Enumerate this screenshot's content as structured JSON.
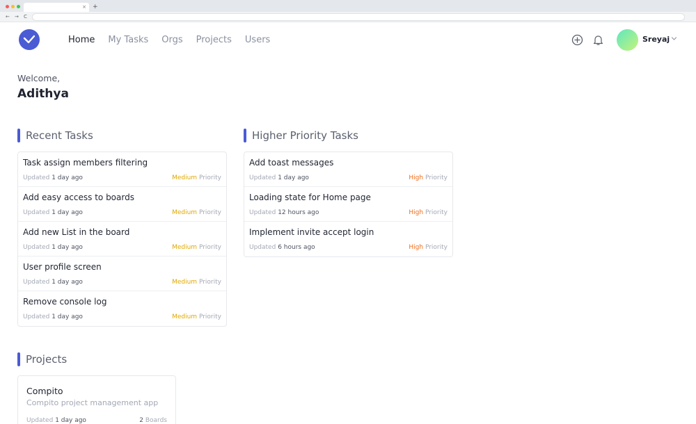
{
  "browser": {
    "tab_close": "×",
    "new_tab": "+",
    "back": "←",
    "forward": "→",
    "reload": "C"
  },
  "nav": {
    "items": [
      {
        "label": "Home",
        "active": true
      },
      {
        "label": "My Tasks",
        "active": false
      },
      {
        "label": "Orgs",
        "active": false
      },
      {
        "label": "Projects",
        "active": false
      },
      {
        "label": "Users",
        "active": false
      }
    ]
  },
  "header": {
    "username": "Sreyaj",
    "add_icon": "plus-circle-icon",
    "bell_icon": "bell-icon"
  },
  "welcome": {
    "greeting": "Welcome,",
    "name": "Adithya"
  },
  "recent_tasks": {
    "title": "Recent Tasks",
    "items": [
      {
        "title": "Task assign members filtering",
        "updated_label": "Updated",
        "updated": "1 day ago",
        "priority": "Medium",
        "priority_suffix": "Priority"
      },
      {
        "title": "Add easy access to boards",
        "updated_label": "Updated",
        "updated": "1 day ago",
        "priority": "Medium",
        "priority_suffix": "Priority"
      },
      {
        "title": "Add new List in the board",
        "updated_label": "Updated",
        "updated": "1 day ago",
        "priority": "Medium",
        "priority_suffix": "Priority"
      },
      {
        "title": "User profile screen",
        "updated_label": "Updated",
        "updated": "1 day ago",
        "priority": "Medium",
        "priority_suffix": "Priority"
      },
      {
        "title": "Remove console log",
        "updated_label": "Updated",
        "updated": "1 day ago",
        "priority": "Medium",
        "priority_suffix": "Priority"
      }
    ]
  },
  "priority_tasks": {
    "title": "Higher Priority Tasks",
    "items": [
      {
        "title": "Add toast messages",
        "updated_label": "Updated",
        "updated": "1 day ago",
        "priority": "High",
        "priority_suffix": "Priority"
      },
      {
        "title": "Loading state for Home page",
        "updated_label": "Updated",
        "updated": "12 hours ago",
        "priority": "High",
        "priority_suffix": "Priority"
      },
      {
        "title": "Implement invite accept login",
        "updated_label": "Updated",
        "updated": "6 hours ago",
        "priority": "High",
        "priority_suffix": "Priority"
      }
    ]
  },
  "projects": {
    "title": "Projects",
    "items": [
      {
        "name": "Compito",
        "description": "Compito project management app",
        "updated_label": "Updated",
        "updated": "1 day ago",
        "boards_count": "2",
        "boards_label": "Boards"
      }
    ]
  },
  "colors": {
    "accent": "#4a5bd4",
    "medium": "#e0a800",
    "high": "#ef6c1a"
  }
}
